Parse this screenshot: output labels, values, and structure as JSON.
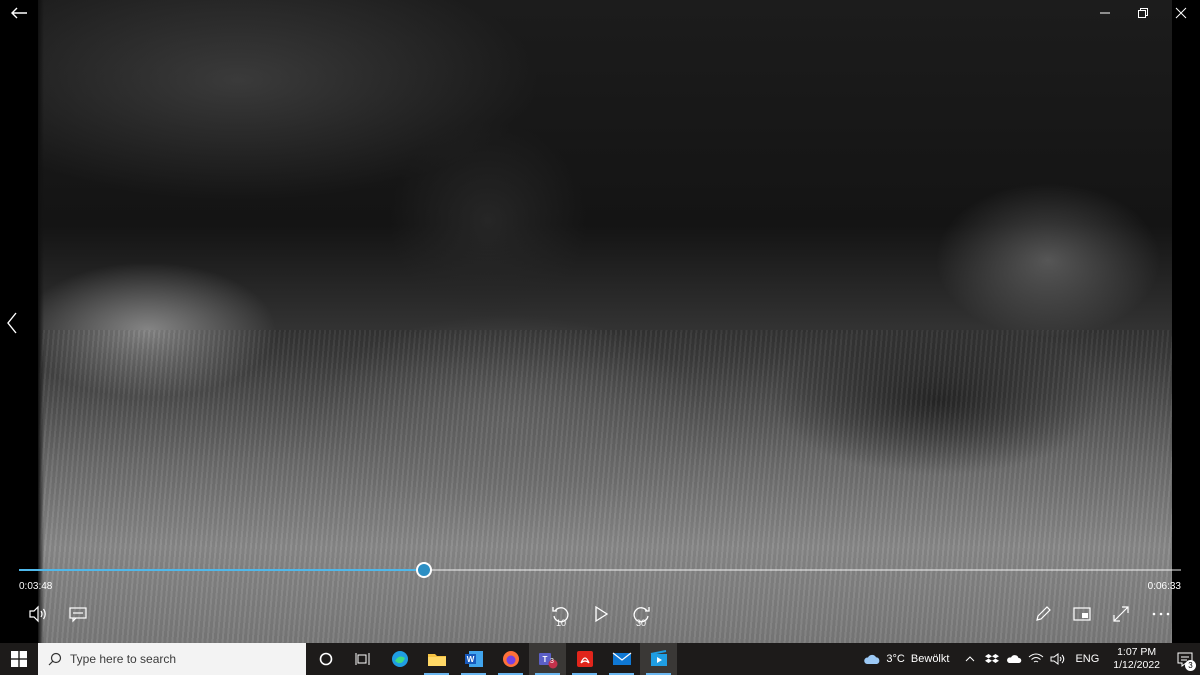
{
  "player": {
    "current_time": "0:03:48",
    "total_time": "0:06:33",
    "progress": 0.3486,
    "skip_back": "10",
    "skip_forward": "30",
    "accent_color": "#4fb8ea"
  },
  "taskbar": {
    "search_placeholder": "Type here to search",
    "teams_badge": "3",
    "weather": "3°C  Bewölkt",
    "language": "ENG",
    "time": "1:07 PM",
    "date": "1/12/2022",
    "notification_count": "3",
    "apps": [
      "task-view",
      "edge",
      "file-explorer",
      "word",
      "firefox",
      "teams",
      "acrobat",
      "mail",
      "movies-tv"
    ]
  }
}
